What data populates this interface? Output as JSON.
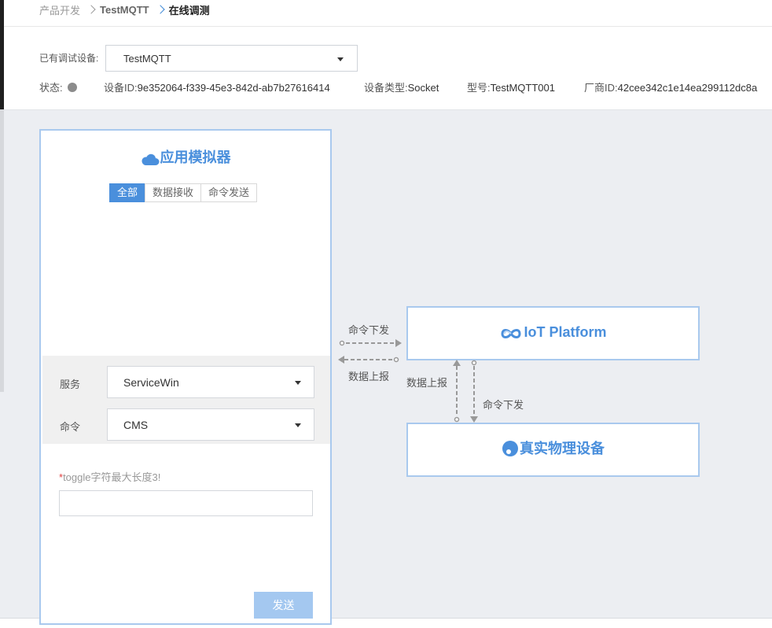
{
  "breadcrumb": {
    "items": [
      "产品开发",
      "TestMQTT",
      "在线调测"
    ]
  },
  "device": {
    "label": "已有调试设备:",
    "selected": "TestMQTT"
  },
  "info": {
    "status_label": "状态:",
    "status_color": "#8c8c8c",
    "device_id_label": "设备ID:",
    "device_id": "9e352064-f339-45e3-842d-ab7b27616414",
    "device_type_label": "设备类型:",
    "device_type": "Socket",
    "model_label": "型号:",
    "model": "TestMQTT001",
    "vendor_label": "厂商ID:",
    "vendor_id": "42cee342c1e14ea299112dc8a"
  },
  "simulator": {
    "title": "应用模拟器",
    "icon": "cloud-icon",
    "tabs": [
      {
        "label": "全部",
        "active": true
      },
      {
        "label": "数据接收",
        "active": false
      },
      {
        "label": "命令发送",
        "active": false
      }
    ],
    "service_label": "服务",
    "service_value": "ServiceWin",
    "command_label": "命令",
    "command_value": "CMS",
    "hint_required": "*",
    "hint_text": "toggle字符最大长度3!",
    "input_value": "",
    "send_label": "发送"
  },
  "platform": {
    "title": "IoT Platform",
    "icon": "infinity-icon"
  },
  "physical_device": {
    "title": "真实物理设备",
    "icon": "device-dot-icon"
  },
  "flows": {
    "app_to_platform": "命令下发",
    "platform_to_app": "数据上报",
    "device_to_platform": "数据上报",
    "platform_to_device": "命令下发"
  },
  "colors": {
    "accent": "#4a8fdc",
    "border_blue": "#a9c9ee",
    "send_disabled": "#a4c8f0",
    "canvas_bg": "#eceef2"
  }
}
